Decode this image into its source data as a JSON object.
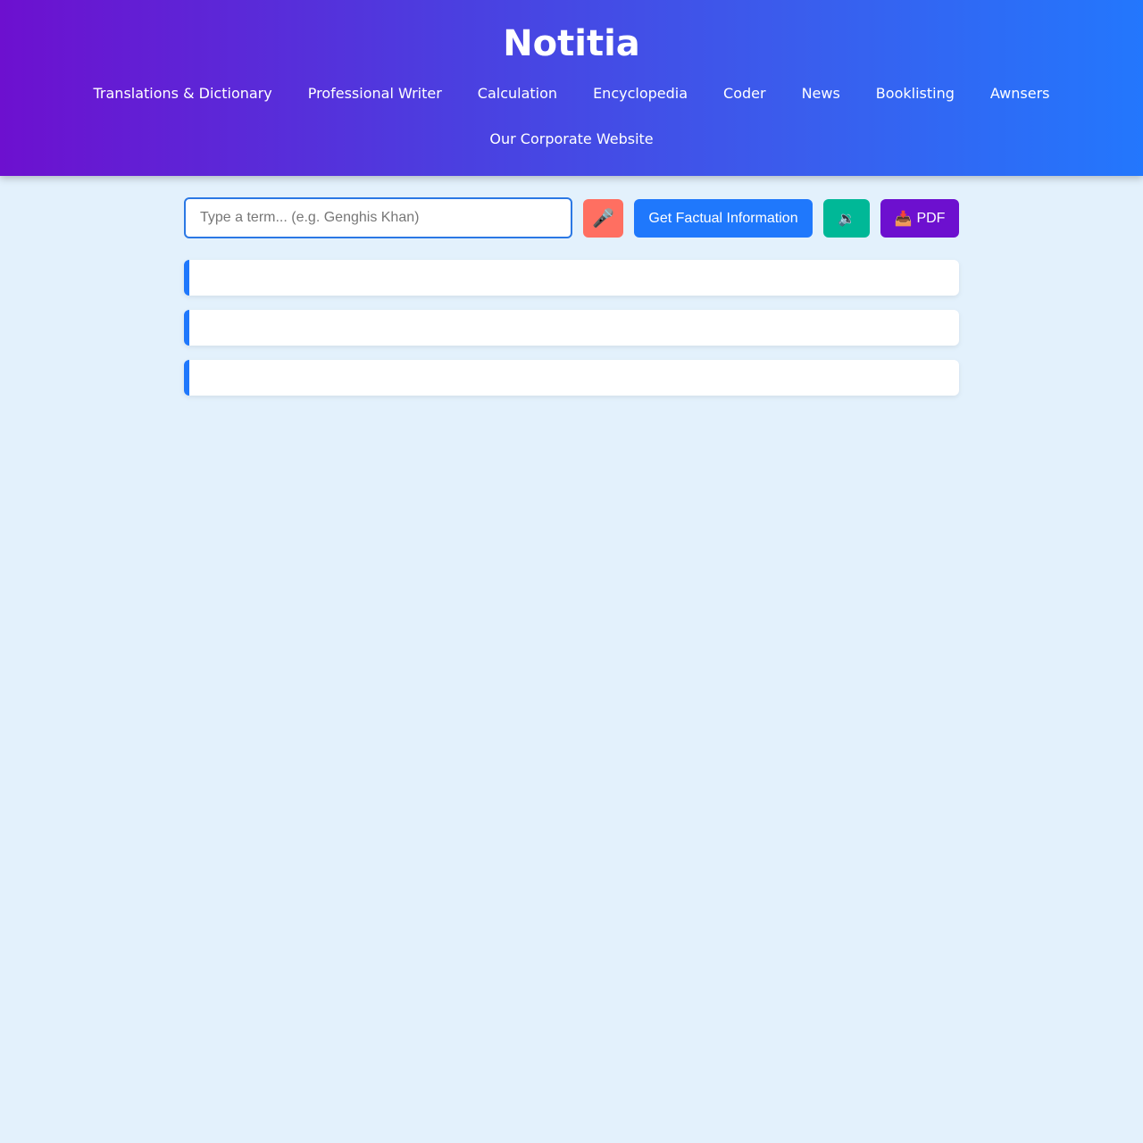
{
  "header": {
    "title": "Notitia",
    "nav_row1": [
      {
        "label": "Translations & Dictionary"
      },
      {
        "label": "Professional Writer"
      },
      {
        "label": "Calculation"
      },
      {
        "label": "Encyclopedia"
      },
      {
        "label": "Coder"
      },
      {
        "label": "News"
      },
      {
        "label": "Booklisting"
      },
      {
        "label": "Awnsers"
      }
    ],
    "nav_row2": [
      {
        "label": "Our Corporate Website"
      }
    ]
  },
  "search": {
    "value": "",
    "placeholder": "Type a term... (e.g. Genghis Khan)"
  },
  "toolbar": {
    "mic_icon": "🎤",
    "fact_label": "Get Factual Information",
    "speak_icon": "🔉",
    "pdf_icon": "📥",
    "pdf_label": "PDF"
  },
  "results": [
    {
      "text": ""
    },
    {
      "text": ""
    },
    {
      "text": ""
    }
  ],
  "colors": {
    "gradient_start": "#6d10cf",
    "gradient_end": "#2377fd",
    "page_background": "#e3f1fc",
    "mic_button": "#ff6f61",
    "fact_button": "#1f78fc",
    "speak_button": "#00b897",
    "pdf_button": "#6d10cf",
    "card_accent": "#1f78fc"
  },
  "icons": {
    "mic": "microphone-icon",
    "speak": "speaker-icon",
    "pdf": "download-tray-icon"
  }
}
